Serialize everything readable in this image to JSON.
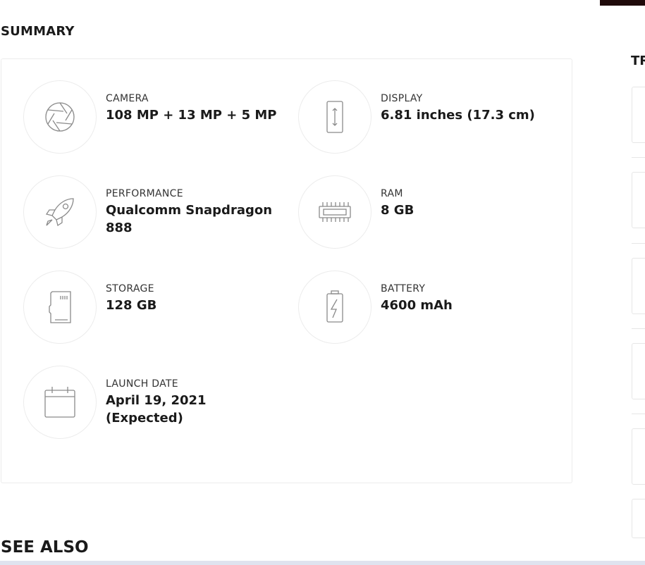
{
  "summary": {
    "title": "SUMMARY",
    "specs": [
      {
        "label": "CAMERA",
        "value": "108 MP + 13 MP + 5 MP",
        "icon": "camera-aperture-icon"
      },
      {
        "label": "DISPLAY",
        "value": "6.81 inches (17.3 cm)",
        "icon": "phone-display-icon"
      },
      {
        "label": "PERFORMANCE",
        "value": "Qualcomm Snapdragon 888",
        "icon": "rocket-icon"
      },
      {
        "label": "RAM",
        "value": "8 GB",
        "icon": "memory-chip-icon"
      },
      {
        "label": "STORAGE",
        "value": "128 GB",
        "icon": "sd-card-icon"
      },
      {
        "label": "BATTERY",
        "value": "4600 mAh",
        "icon": "battery-icon"
      },
      {
        "label": "LAUNCH DATE",
        "value": "April 19, 2021 (Expected)",
        "icon": "calendar-icon"
      }
    ]
  },
  "sidebar": {
    "title": "TR"
  },
  "see_also": {
    "title": "SEE ALSO"
  },
  "colors": {
    "icon_stroke": "#8a8a8a",
    "card_border": "#ececec",
    "text": "#1a1a1a"
  }
}
